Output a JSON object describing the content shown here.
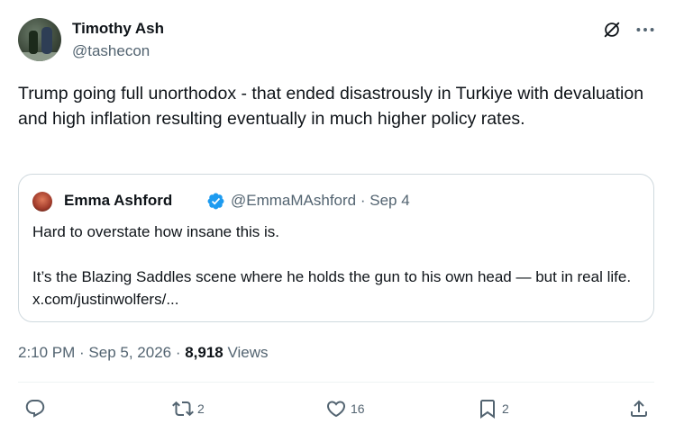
{
  "author": {
    "name": "Timothy Ash",
    "handle": "@tashecon"
  },
  "tweet": {
    "text": "Trump going full unorthodox - that ended disastrously in Turkiye with devaluation and high inflation resulting eventually in much higher policy rates."
  },
  "quote": {
    "name": "Emma Ashford",
    "verified": true,
    "meta": "@EmmaMAshford · Sep 4",
    "line1": "Hard to overstate how insane this is.",
    "line2": "It’s the Blazing Saddles scene where he holds the gun to his own head — but in real life. x.com/justinwolfers/..."
  },
  "meta": {
    "time_date": "2:10 PM · Sep 5, 2026 · ",
    "views_count": "8,918",
    "views_label": " Views"
  },
  "actions": {
    "replies": "",
    "reposts": "2",
    "likes": "16",
    "bookmarks": "2"
  },
  "icons": {
    "header": [
      "grok-icon",
      "more-icon"
    ],
    "actions": [
      "reply-icon",
      "repost-icon",
      "like-icon",
      "bookmark-icon",
      "share-icon"
    ],
    "verified": "verified-badge-icon"
  },
  "colors": {
    "text": "#0f1419",
    "secondary": "#536471",
    "border": "#cfd9de",
    "verified": "#1d9bf0"
  }
}
